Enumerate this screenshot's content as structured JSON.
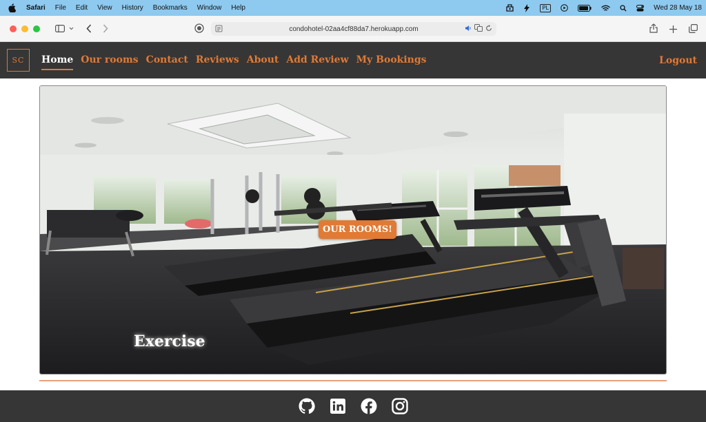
{
  "menubar": {
    "app": "Safari",
    "items": [
      "File",
      "Edit",
      "View",
      "History",
      "Bookmarks",
      "Window",
      "Help"
    ],
    "input_source": "PL",
    "clock": "Wed 28 May  18"
  },
  "browser": {
    "url": "condohotel-02aa4cf88da7.herokuapp.com"
  },
  "site": {
    "logo": "SC",
    "nav": [
      "Home",
      "Our rooms",
      "Contact",
      "Reviews",
      "About",
      "Add Review",
      "My Bookings"
    ],
    "active_nav": "Home",
    "logout": "Logout"
  },
  "hero": {
    "button": "OUR ROOMS!",
    "caption": "Exercise"
  },
  "footer": {
    "icons": [
      "github-icon",
      "linkedin-icon",
      "facebook-icon",
      "instagram-icon"
    ]
  },
  "colors": {
    "accent": "#e07a35",
    "nav_bg": "#363636",
    "menubar_bg": "#8ec9ef"
  }
}
